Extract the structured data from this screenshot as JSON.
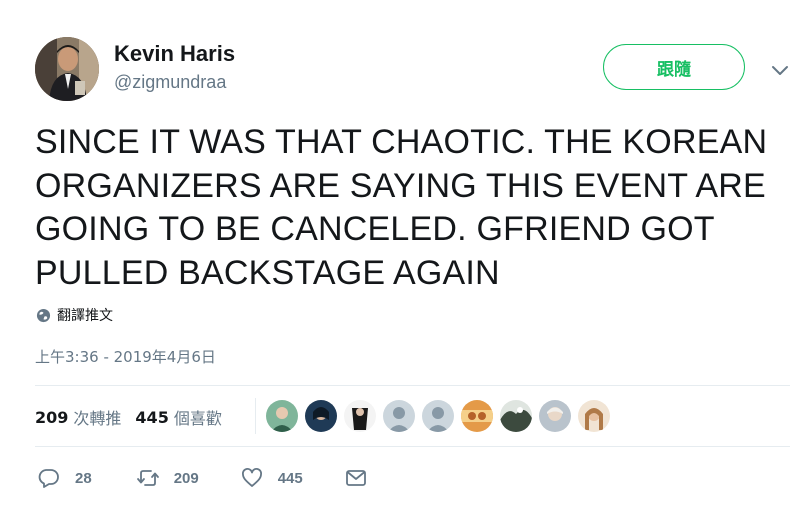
{
  "user": {
    "name": "Kevin Haris",
    "handle": "@zigmundraa"
  },
  "follow_button": {
    "label": "跟隨",
    "color": "#17bf63"
  },
  "tweet": {
    "lines": [
      "SINCE IT WAS THAT CHAOTIC. THE KOREAN",
      "ORGANIZERS ARE SAYING THIS EVENT ARE",
      "GOING TO BE CANCELED. GFRIEND GOT",
      "PULLED BACKSTAGE AGAIN"
    ]
  },
  "translate": {
    "label": "翻譯推文",
    "icon": "globe-icon"
  },
  "timestamp": "上午3:36 - 2019年4月6日",
  "stats": {
    "retweets": {
      "count": "209",
      "label": "次轉推"
    },
    "likes": {
      "count": "445",
      "label": "個喜歡"
    }
  },
  "likers": [
    {
      "icon": "liker-avatar-1",
      "color": "#6aa58a"
    },
    {
      "icon": "liker-avatar-2",
      "color": "#2a4e6e"
    },
    {
      "icon": "liker-avatar-3",
      "color": "#222222"
    },
    {
      "icon": "default-avatar",
      "color": "#ccd6dd"
    },
    {
      "icon": "default-avatar",
      "color": "#ccd6dd"
    },
    {
      "icon": "liker-avatar-6",
      "color": "#d68a3a"
    },
    {
      "icon": "liker-avatar-7",
      "color": "#7a8a7a"
    },
    {
      "icon": "liker-avatar-8",
      "color": "#9aa4ae"
    },
    {
      "icon": "liker-avatar-9",
      "color": "#c9a88a"
    }
  ],
  "actions": {
    "reply": {
      "icon": "reply-icon",
      "count": "28"
    },
    "retweet": {
      "icon": "retweet-icon",
      "count": "209"
    },
    "like": {
      "icon": "heart-icon",
      "count": "445"
    },
    "dm": {
      "icon": "envelope-icon"
    }
  },
  "colors": {
    "text": "#14171a",
    "secondary": "#657786",
    "divider": "#e6ecf0"
  }
}
